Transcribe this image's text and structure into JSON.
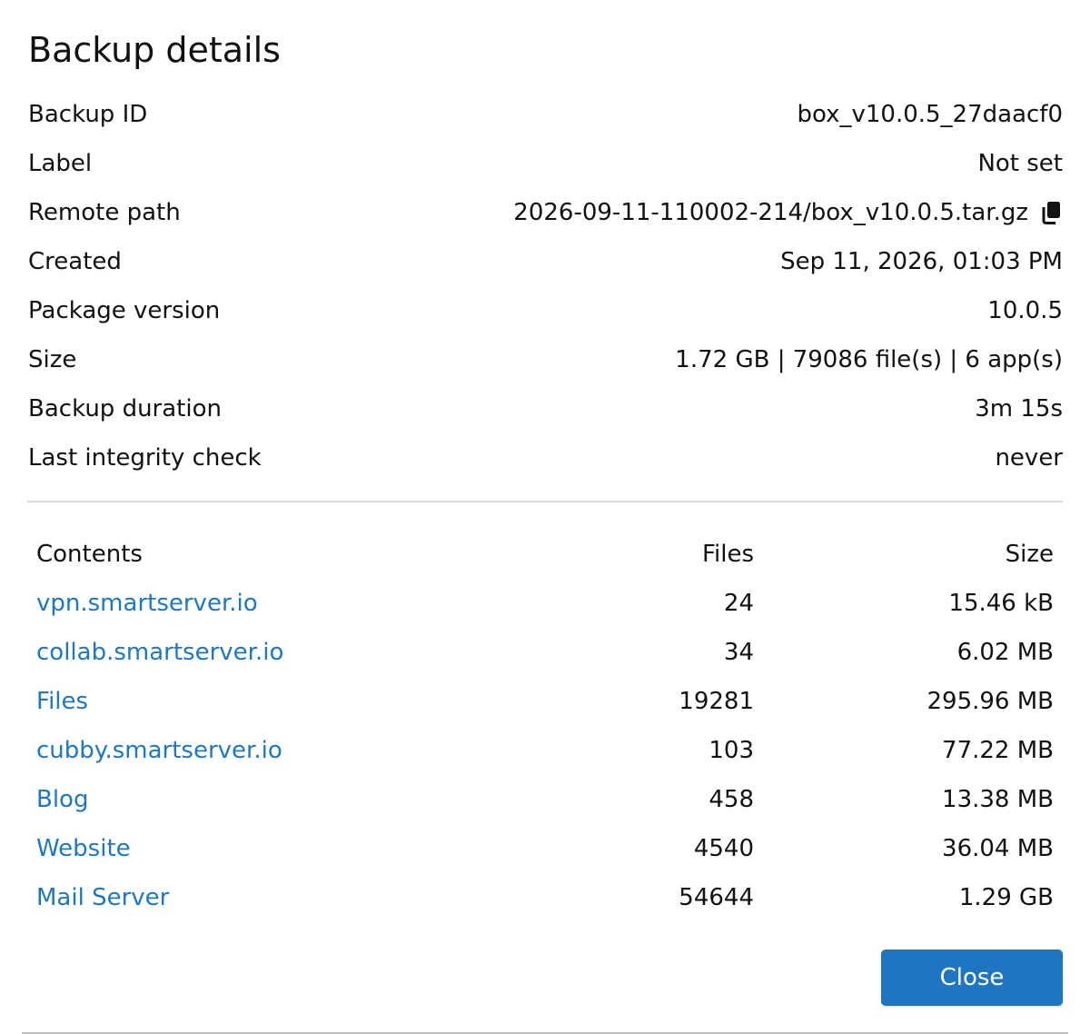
{
  "dialog": {
    "title": "Backup details",
    "details": [
      {
        "label": "Backup ID",
        "value": "box_v10.0.5_27daacf0"
      },
      {
        "label": "Label",
        "value": "Not set"
      },
      {
        "label": "Remote path",
        "value": "2026-09-11-110002-214/box_v10.0.5.tar.gz",
        "icon": "copy-icon"
      },
      {
        "label": "Created",
        "value": "Sep 11, 2026, 01:03 PM"
      },
      {
        "label": "Package version",
        "value": "10.0.5"
      },
      {
        "label": "Size",
        "value": "1.72 GB | 79086 file(s) | 6 app(s)"
      },
      {
        "label": "Backup duration",
        "value": "3m 15s"
      },
      {
        "label": "Last integrity check",
        "value": "never"
      }
    ],
    "contents": {
      "headers": {
        "name": "Contents",
        "files": "Files",
        "size": "Size"
      },
      "rows": [
        {
          "name": "vpn.smartserver.io",
          "files": "24",
          "size": "15.46 kB"
        },
        {
          "name": "collab.smartserver.io",
          "files": "34",
          "size": "6.02 MB"
        },
        {
          "name": "Files",
          "files": "19281",
          "size": "295.96 MB"
        },
        {
          "name": "cubby.smartserver.io",
          "files": "103",
          "size": "77.22 MB"
        },
        {
          "name": "Blog",
          "files": "458",
          "size": "13.38 MB"
        },
        {
          "name": "Website",
          "files": "4540",
          "size": "36.04 MB"
        },
        {
          "name": "Mail Server",
          "files": "54644",
          "size": "1.29 GB"
        }
      ]
    },
    "close_label": "Close",
    "colors": {
      "link": "#1f77c1",
      "button": "#1f75bf",
      "divider": "#d9d9d9"
    }
  }
}
